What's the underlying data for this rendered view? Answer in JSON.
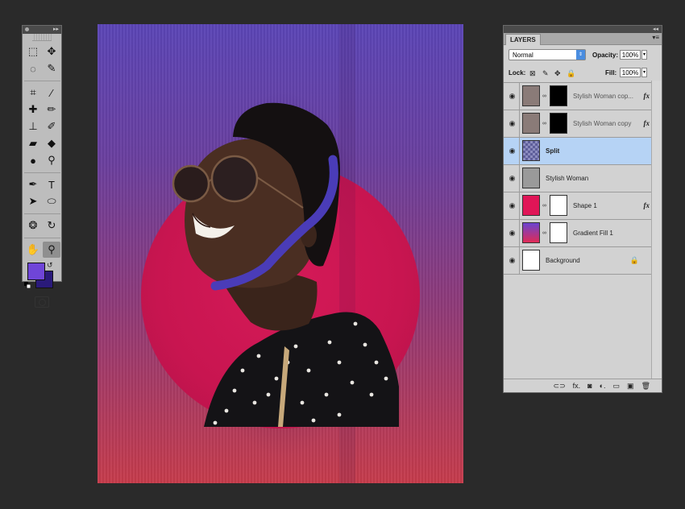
{
  "tools_panel": {
    "collapse_glyph": "▸▸",
    "tools": [
      {
        "name": "marquee-icon",
        "glyph": "⬚"
      },
      {
        "name": "move-icon",
        "glyph": "✥"
      },
      {
        "name": "lasso-icon",
        "glyph": "◌"
      },
      {
        "name": "quick-select-icon",
        "glyph": "✎"
      },
      {
        "name": "crop-icon",
        "glyph": "⌗"
      },
      {
        "name": "eyedropper-icon",
        "glyph": "⁄"
      },
      {
        "name": "healing-brush-icon",
        "glyph": "✚"
      },
      {
        "name": "brush-icon",
        "glyph": "✏"
      },
      {
        "name": "stamp-icon",
        "glyph": "⊥"
      },
      {
        "name": "history-brush-icon",
        "glyph": "✐"
      },
      {
        "name": "eraser-icon",
        "glyph": "▰"
      },
      {
        "name": "paint-bucket-icon",
        "glyph": "◆"
      },
      {
        "name": "blur-icon",
        "glyph": "●"
      },
      {
        "name": "dodge-icon",
        "glyph": "⚲"
      },
      {
        "name": "pen-icon",
        "glyph": "✒"
      },
      {
        "name": "type-icon",
        "glyph": "T"
      },
      {
        "name": "path-select-icon",
        "glyph": "➤"
      },
      {
        "name": "ellipse-shape-icon",
        "glyph": "⬭"
      },
      {
        "name": "3d-rotate-icon",
        "glyph": "❂"
      },
      {
        "name": "3d-orbit-icon",
        "glyph": "↻"
      },
      {
        "name": "hand-icon",
        "glyph": "✋"
      },
      {
        "name": "zoom-icon",
        "glyph": "⚲"
      }
    ],
    "foreground_color": "#6f45d8",
    "background_color": "#2a1a7a"
  },
  "layers_panel": {
    "tab_label": "LAYERS",
    "menu_glyph": "▾≡",
    "blend_mode": "Normal",
    "opacity_label": "Opacity:",
    "opacity_value": "100%",
    "lock_label": "Lock:",
    "fill_label": "Fill:",
    "fill_value": "100%",
    "layers": [
      {
        "name": "Stylish Woman cop...",
        "has_mask": true,
        "has_fx": true,
        "visible": true
      },
      {
        "name": "Stylish Woman copy",
        "has_mask": true,
        "has_fx": true,
        "visible": true
      },
      {
        "name": "Split",
        "has_mask": false,
        "has_fx": false,
        "visible": true,
        "selected": true
      },
      {
        "name": "Stylish Woman",
        "has_mask": false,
        "has_fx": false,
        "visible": true
      },
      {
        "name": "Shape 1",
        "has_mask": true,
        "has_fx": true,
        "visible": true
      },
      {
        "name": "Gradient Fill 1",
        "has_mask": true,
        "has_fx": false,
        "visible": true
      },
      {
        "name": "Background",
        "has_mask": false,
        "has_fx": false,
        "visible": true,
        "locked": true
      }
    ],
    "fx_label": "fx",
    "footer_icons": [
      "link-layers-icon",
      "fx-icon",
      "add-mask-icon",
      "adjustment-layer-icon",
      "new-group-icon",
      "new-layer-icon",
      "delete-layer-icon"
    ],
    "footer_glyphs": [
      "⊂⊃",
      "fx.",
      "◙",
      "◐.",
      "▭",
      "▣",
      "🗑"
    ]
  }
}
